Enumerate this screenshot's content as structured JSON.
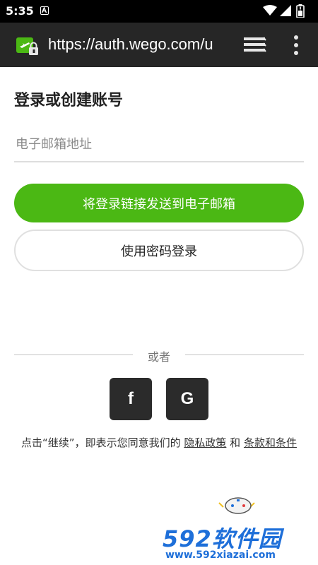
{
  "status_bar": {
    "time": "5:35",
    "notification_icon": "a-notification-icon",
    "icons": [
      "wifi-icon",
      "signal-icon",
      "battery-icon"
    ]
  },
  "browser": {
    "url": "https://auth.wego.com/u",
    "site_icon": "wego-lock-icon",
    "tabs_icon": "tabs-stack-icon",
    "menu_icon": "overflow-menu-icon"
  },
  "login": {
    "title": "登录或创建账号",
    "email_placeholder": "电子邮箱地址",
    "email_value": "",
    "send_link_label": "将登录链接发送到电子邮箱",
    "password_login_label": "使用密码登录",
    "divider_text": "或者",
    "facebook_icon": "facebook-icon",
    "facebook_label": "f",
    "google_icon": "google-icon",
    "google_label": "G",
    "terms_prefix": "点击“继续”，即表示您同意我们的",
    "privacy_link": "隐私政策",
    "terms_and": "和",
    "terms_link": "条款和条件"
  },
  "watermark": {
    "title": "592软件园",
    "url": "www.592xiazai.com"
  },
  "colors": {
    "primary": "#4bb814",
    "toolbar": "#262626",
    "social_button": "#2b2b2b",
    "watermark": "#1e6fd9"
  }
}
